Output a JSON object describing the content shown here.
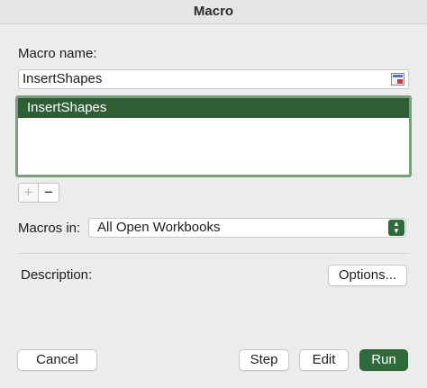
{
  "window": {
    "title": "Macro"
  },
  "macro_name": {
    "label": "Macro name:",
    "value": "InsertShapes",
    "picker_icon": "range-picker-icon"
  },
  "macro_list": {
    "items": [
      "InsertShapes"
    ],
    "selected_index": 0,
    "selected_color": "#2f5e35"
  },
  "list_controls": {
    "add": "+",
    "remove": "−"
  },
  "macros_in": {
    "label": "Macros in:",
    "value": "All Open Workbooks",
    "arrow": "⌃\n⌄"
  },
  "description": {
    "label": "Description:"
  },
  "buttons": {
    "options": "Options...",
    "cancel": "Cancel",
    "step": "Step",
    "edit": "Edit",
    "run": "Run"
  },
  "colors": {
    "accent": "#2f6a3c",
    "list_border": "#7a9e7d"
  }
}
